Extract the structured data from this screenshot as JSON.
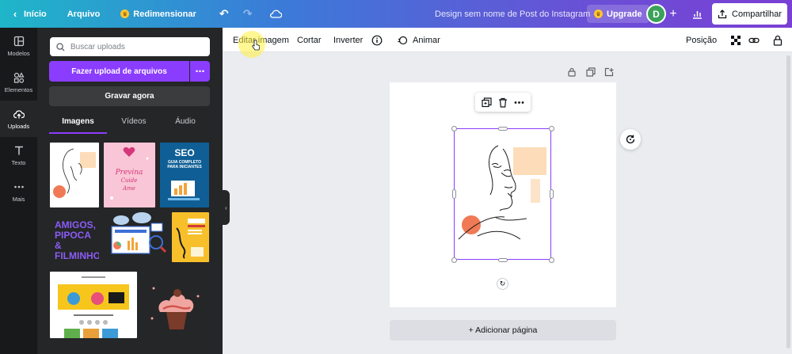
{
  "topbar": {
    "inicio": "Início",
    "arquivo": "Arquivo",
    "redimensionar": "Redimensionar",
    "doc_title": "Design sem nome de Post do Instagram",
    "upgrade": "Upgrade",
    "avatar_initial": "D",
    "compartilhar": "Compartilhar"
  },
  "rail": [
    {
      "label": "Modelos",
      "icon": "layout-icon"
    },
    {
      "label": "Elementos",
      "icon": "shapes-icon"
    },
    {
      "label": "Uploads",
      "icon": "cloud-upload-icon",
      "active": true
    },
    {
      "label": "Texto",
      "icon": "text-icon"
    },
    {
      "label": "Mais",
      "icon": "more-icon"
    }
  ],
  "panel": {
    "search_placeholder": "Buscar uploads",
    "upload_btn": "Fazer upload de arquivos",
    "record_btn": "Gravar agora",
    "tabs": [
      "Imagens",
      "Vídeos",
      "Áudio"
    ],
    "thumbs": {
      "seo_title": "SEO",
      "seo_sub": "GUIA COMPLETO PARA INICIANTES",
      "amigos": "AMIGOS, PIPOCA & FILMINHO."
    }
  },
  "toolbar": {
    "editar": "Editar imagem",
    "cortar": "Cortar",
    "inverter": "Inverter",
    "animar": "Animar",
    "posicao": "Posição"
  },
  "canvas": {
    "add_page": "+ Adicionar página"
  },
  "colors": {
    "accent": "#8b3dff",
    "peach": "#fddcb9",
    "coral": "#f07a55"
  }
}
